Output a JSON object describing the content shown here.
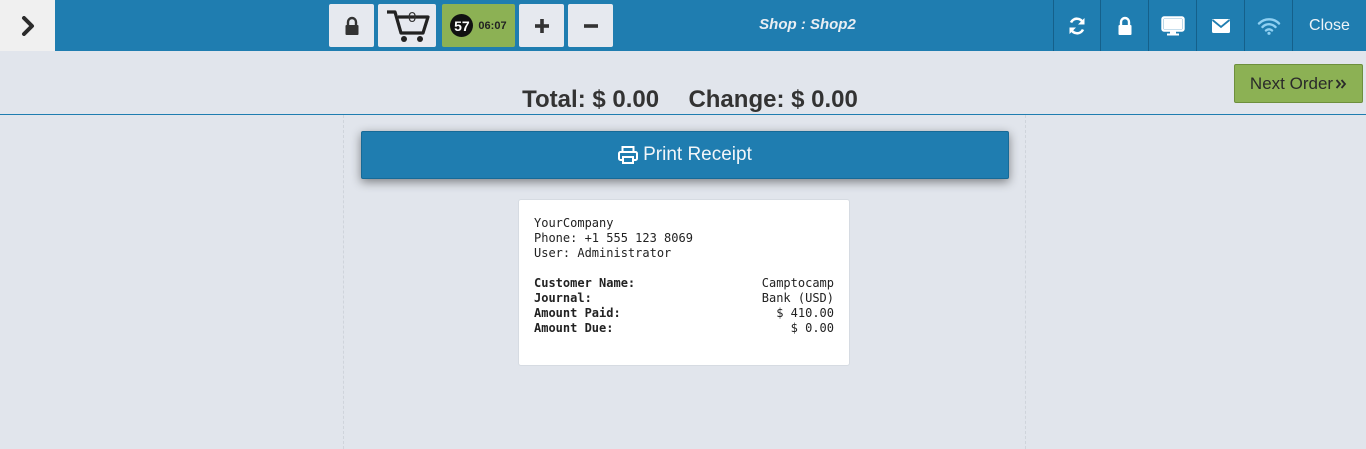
{
  "toolbar": {
    "cart_count": "0",
    "timer_badge": "57",
    "timer_time": "06:07",
    "shop_title": "Shop : Shop2",
    "close_label": "Close"
  },
  "icons": {
    "toggle": "chevron-right-icon",
    "lock": "lock-icon",
    "cart": "cart-icon",
    "plus": "plus-icon",
    "minus": "minus-icon",
    "refresh": "refresh-icon",
    "screen": "desktop-icon",
    "mail": "envelope-icon",
    "wifi": "wifi-icon",
    "print": "print-icon",
    "next": "double-chevron-right-icon"
  },
  "colors": {
    "primary": "#1f7db0",
    "accent_green": "#8cb154",
    "background": "#e1e5ec"
  },
  "summary": {
    "total_label": "Total:",
    "total_value": "$ 0.00",
    "change_label": "Change:",
    "change_value": "$ 0.00",
    "next_order_label": "Next Order"
  },
  "print": {
    "label": "Print Receipt"
  },
  "receipt": {
    "company": "YourCompany",
    "phone": "Phone: +1 555 123 8069",
    "user": "User: Administrator",
    "rows": [
      {
        "label": "Customer Name:",
        "value": "Camptocamp"
      },
      {
        "label": "Journal:",
        "value": "Bank (USD)"
      },
      {
        "label": "Amount Paid:",
        "value": "$ 410.00"
      },
      {
        "label": "Amount Due:",
        "value": "$ 0.00"
      }
    ]
  }
}
